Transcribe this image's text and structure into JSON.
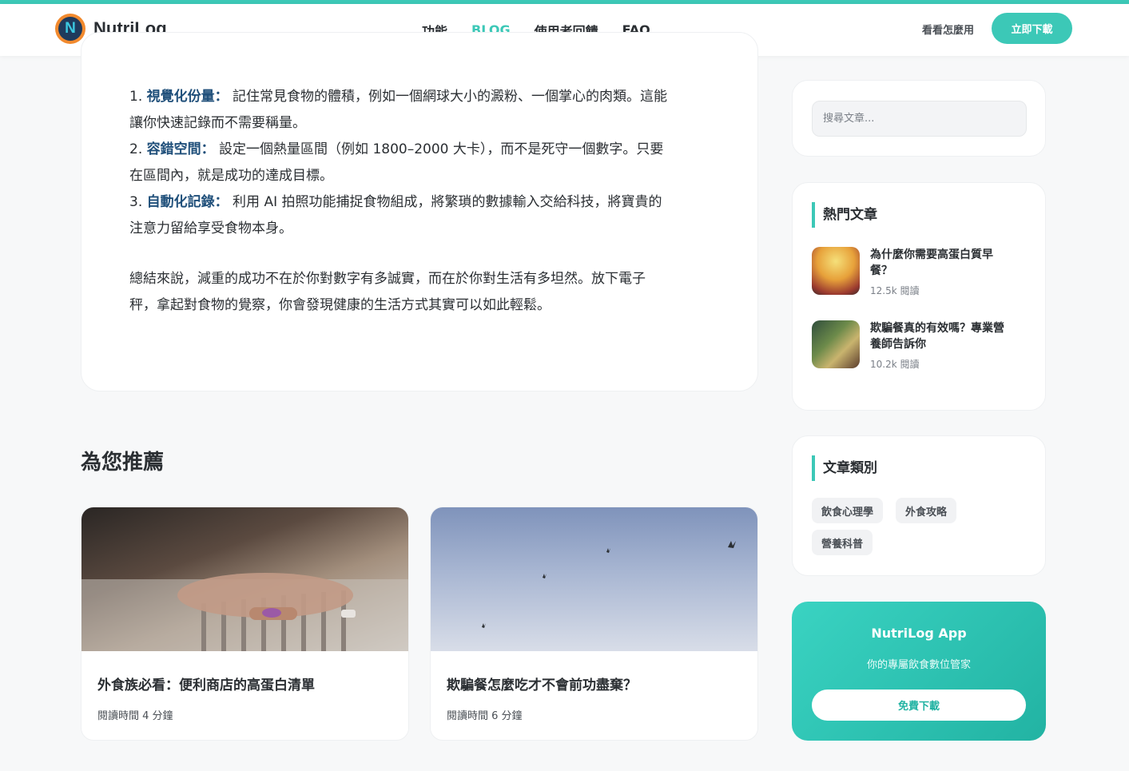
{
  "brand": {
    "name": "NutriLog",
    "logo_letter": "N"
  },
  "nav": {
    "items": [
      "功能",
      "BLOG",
      "使用者回饋",
      "FAQ"
    ],
    "active": "BLOG"
  },
  "header": {
    "how_label": "看看怎麼用",
    "download_label": "立即下載"
  },
  "article": {
    "points": [
      {
        "num": "1.",
        "term": "視覺化份量：",
        "line1": " 記住常見食物的體積，例如一個網球大小的澱粉、一個掌心的肉類。這能",
        "line2": "讓你快速記錄而不需要稱量。"
      },
      {
        "num": "2.",
        "term": "容錯空間：",
        "line1": " 設定一個熱量區間（例如 1800–2000 大卡），而不是死守一個數字。只要",
        "line2": "在區間內，就是成功的達成目標。"
      },
      {
        "num": "3.",
        "term": "自動化記錄：",
        "line1": " 利用 AI 拍照功能捕捉食物組成，將繁瑣的數據輸入交給科技，將寶貴的",
        "line2": "注意力留給享受食物本身。"
      }
    ],
    "conclusion_line1": "總結來說，減重的成功不在於你對數字有多誠實，而在於你對生活有多坦然。放下電子",
    "conclusion_line2": "秤，拿起對食物的覺察，你會發現健康的生活方式其實可以如此輕鬆。"
  },
  "recommend": {
    "title": "為您推薦",
    "cards": [
      {
        "title": "外食族必看：便利商店的高蛋白清單",
        "meta": "閱讀時間 4 分鐘"
      },
      {
        "title": "欺騙餐怎麼吃才不會前功盡棄？",
        "meta": "閱讀時間 6 分鐘"
      }
    ]
  },
  "sidebar": {
    "search_placeholder": "搜尋文章...",
    "popular": {
      "heading": "熱門文章",
      "items": [
        {
          "title_line1": "為什麼你需要高蛋白質早",
          "title_line2": "餐？",
          "reads": "12.5k 閱讀"
        },
        {
          "title_line1": "欺騙餐真的有效嗎？專業營",
          "title_line2": "養師告訴你",
          "reads": "10.2k 閱讀"
        }
      ]
    },
    "categories": {
      "heading": "文章類別",
      "tags": [
        "飲食心理學",
        "外食攻略",
        "營養科普"
      ]
    },
    "app": {
      "title": "NutriLog App",
      "subtitle": "你的專屬飲食數位管家",
      "button": "免費下載"
    }
  },
  "colors": {
    "accent": "#3cc8b7",
    "highlight": "#1f4f7a",
    "logo_orange": "#f28a2e",
    "logo_navy": "#1f3a5c"
  }
}
